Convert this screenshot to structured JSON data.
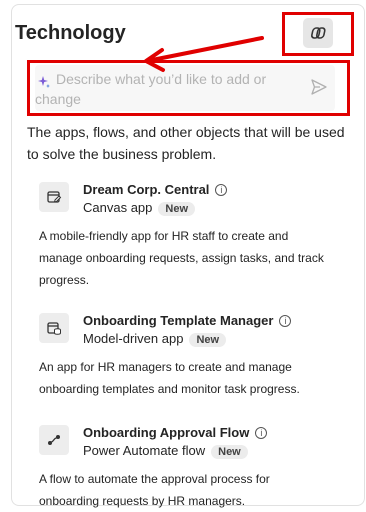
{
  "panel": {
    "title": "Technology",
    "prompt_placeholder": "Describe what you’d like to add or change",
    "description": "The apps, flows, and other objects that will be used to solve the business problem."
  },
  "items": [
    {
      "name": "Dream Corp. Central",
      "type": "Canvas app",
      "badge": "New",
      "description": "A mobile-friendly app for HR staff to create and manage onboarding requests, assign tasks, and track progress."
    },
    {
      "name": "Onboarding Template Manager",
      "type": "Model-driven app",
      "badge": "New",
      "description": "An app for HR managers to create and manage onboarding templates and monitor task progress."
    },
    {
      "name": "Onboarding Approval Flow",
      "type": "Power Automate flow",
      "badge": "New",
      "description": "A flow to automate the approval process for onboarding requests by HR managers."
    }
  ],
  "colors": {
    "highlight": "#e00000",
    "accent_spark": "#7b5cd6"
  }
}
